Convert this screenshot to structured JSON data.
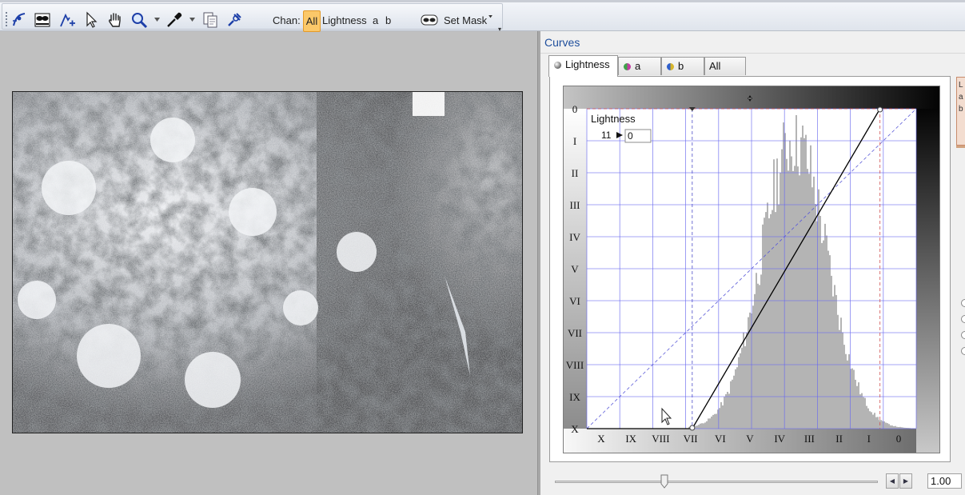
{
  "toolbar": {
    "icons": [
      "curve-point-tool-icon",
      "mask-icon",
      "add-point-icon",
      "select-arrow-icon",
      "hand-tool-icon",
      "zoom-icon",
      "eyedropper-icon",
      "copy-icon",
      "link-icon"
    ],
    "chan_label": "Chan:",
    "channels": [
      "All",
      "Lightness",
      "a",
      "b"
    ],
    "active_channel": "All",
    "set_mask_label": "Set Mask",
    "accent_color": "#fbc869"
  },
  "panel": {
    "title": "Curves",
    "tabs": [
      {
        "label": "Lightness",
        "icon": "lightness-dot-icon",
        "active": true
      },
      {
        "label": "a",
        "icon": "a-channel-dot-icon",
        "active": false
      },
      {
        "label": "b",
        "icon": "b-channel-dot-icon",
        "active": false
      },
      {
        "label": "All",
        "active": false
      }
    ],
    "curve": {
      "channel_label": "Lightness",
      "readout_input": "11",
      "readout_output": "0",
      "y_zone_labels": [
        "0",
        "I",
        "II",
        "III",
        "IV",
        "V",
        "VI",
        "VII",
        "VIII",
        "IX",
        "X"
      ],
      "x_zone_labels": [
        "X",
        "IX",
        "VIII",
        "VII",
        "VI",
        "V",
        "IV",
        "III",
        "II",
        "I",
        "0"
      ],
      "black_point": 0.32,
      "white_point": 0.89,
      "grid_color": "#6a6af0",
      "histogram_color": "#b4b4b4"
    },
    "side_strip_letters": [
      "L",
      "a",
      "b"
    ],
    "slider": {
      "value": "1.00",
      "position": 0.34
    }
  }
}
